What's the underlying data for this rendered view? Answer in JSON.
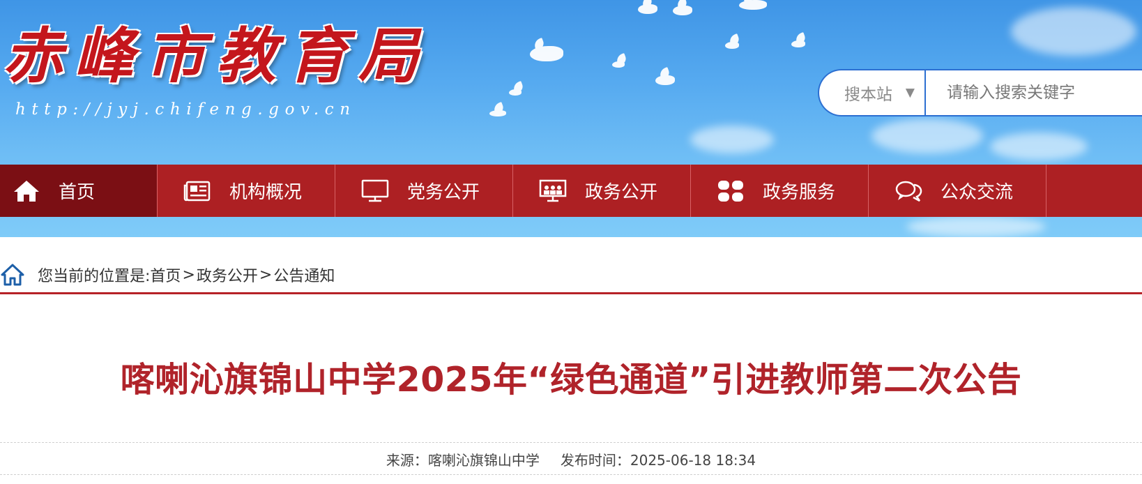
{
  "header": {
    "site_title": "赤峰市教育局",
    "site_url": "http://jyj.chifeng.gov.cn"
  },
  "search": {
    "scope": "搜本站",
    "scope_arrow": "▼",
    "placeholder": "请输入搜索关键字"
  },
  "nav": {
    "items": [
      {
        "label": "首页",
        "icon": "home-icon",
        "active": true
      },
      {
        "label": "机构概况",
        "icon": "newspaper-icon"
      },
      {
        "label": "党务公开",
        "icon": "monitor-icon"
      },
      {
        "label": "政务公开",
        "icon": "presentation-icon"
      },
      {
        "label": "政务服务",
        "icon": "grid-icon"
      },
      {
        "label": "公众交流",
        "icon": "chat-icon"
      }
    ]
  },
  "breadcrumb": {
    "prefix": "您当前的位置是:",
    "items": [
      "首页",
      "政务公开",
      "公告通知"
    ],
    "separator": ">"
  },
  "article": {
    "title": "喀喇沁旗锦山中学2025年“绿色通道”引进教师第二次公告",
    "source_label": "来源：",
    "source": "喀喇沁旗锦山中学",
    "date_label": "发布时间：",
    "date": "2025-06-18 18:34"
  },
  "colors": {
    "nav_bg": "#ad2023",
    "nav_active_bg": "#7b0f14",
    "title_red": "#b0232a",
    "search_border": "#2c6fd1",
    "sky": "#56aaf0"
  }
}
